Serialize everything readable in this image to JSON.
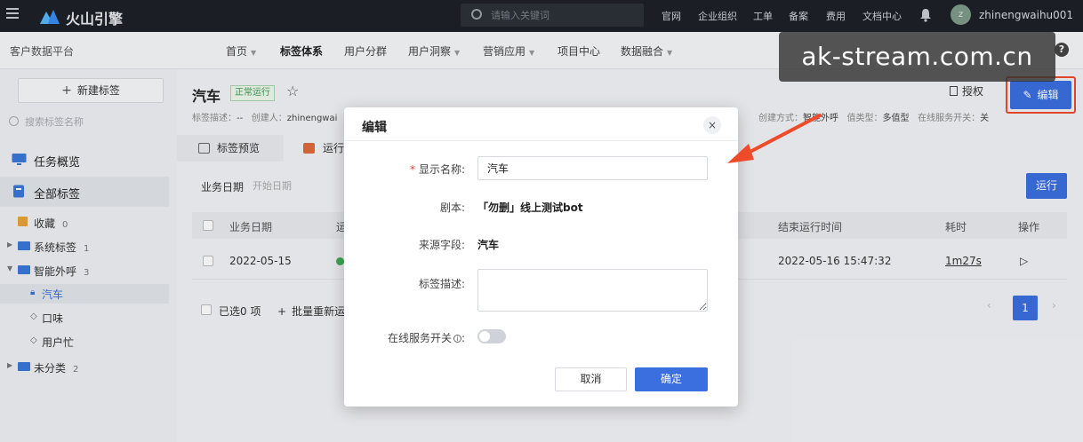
{
  "topbar": {
    "brand": "火山引擎",
    "search_placeholder": "请输入关键词",
    "nav": [
      "官网",
      "企业组织",
      "工单",
      "备案",
      "费用",
      "文档中心"
    ],
    "avatar_initial": "z",
    "username": "zhinengwaihu001"
  },
  "subbar": {
    "platform": "客户数据平台",
    "nav": [
      {
        "label": "首页",
        "caret": true
      },
      {
        "label": "标签体系",
        "caret": false,
        "active": true
      },
      {
        "label": "用户分群",
        "caret": false
      },
      {
        "label": "用户洞察",
        "caret": true
      },
      {
        "label": "营销应用",
        "caret": true
      },
      {
        "label": "项目中心",
        "caret": false
      },
      {
        "label": "数据融合",
        "caret": true
      }
    ],
    "help": "?"
  },
  "watermark": "ak-stream.com.cn",
  "sidebar": {
    "new_tag": "新建标签",
    "search_placeholder": "搜索标签名称",
    "items": [
      {
        "label": "任务概览"
      },
      {
        "label": "全部标签"
      }
    ],
    "favorites": {
      "label": "收藏",
      "count": "0"
    },
    "groups": [
      {
        "label": "系统标签",
        "count": "1"
      },
      {
        "label": "智能外呼",
        "count": "3"
      }
    ],
    "children": [
      "汽车",
      "口味",
      "用户忙"
    ],
    "uncategorized": {
      "label": "未分类",
      "count": "2"
    }
  },
  "main": {
    "title": "汽车",
    "status": "正常运行",
    "meta": {
      "desc_label": "标签描述：",
      "desc_value": "--",
      "creator_label": "创建人：",
      "creator_value": "zhinengwai",
      "create_method_label": "创建方式：",
      "create_method_value": "智能外呼",
      "value_type_label": "值类型：",
      "value_type_value": "多值型",
      "online_label": "在线服务开关：",
      "online_value": "关"
    },
    "auth_button": "授权",
    "edit_button": "编辑",
    "tabs": [
      "标签预览",
      "运行"
    ],
    "date_filter_label": "业务日期",
    "date_filter_placeholder": "开始日期",
    "run_button": "运行",
    "table": {
      "headers": [
        "业务日期",
        "运",
        "结束运行时间",
        "耗时",
        "操作"
      ],
      "rows": [
        {
          "date": "2022-05-15",
          "end_time": "2022-05-16 15:47:32",
          "duration": "1m27s",
          "action": "▷"
        }
      ]
    },
    "selected_label": "已选0 项",
    "batch_label": "批量重新运",
    "pagination": {
      "prev": "‹",
      "current": "1",
      "next": "›"
    }
  },
  "modal": {
    "title": "编辑",
    "close": "×",
    "fields": {
      "display_name_label": "显示名称:",
      "display_name_value": "汽车",
      "script_label": "剧本:",
      "script_value": "「勿删」线上测试bot",
      "source_field_label": "来源字段:",
      "source_field_value": "汽车",
      "desc_label": "标签描述:",
      "online_label": "在线服务开关"
    },
    "cancel": "取消",
    "ok": "确定"
  },
  "colors": {
    "primary": "#3b6fe0",
    "annotation": "#ee4b2b",
    "topbar": "#1d2027"
  }
}
